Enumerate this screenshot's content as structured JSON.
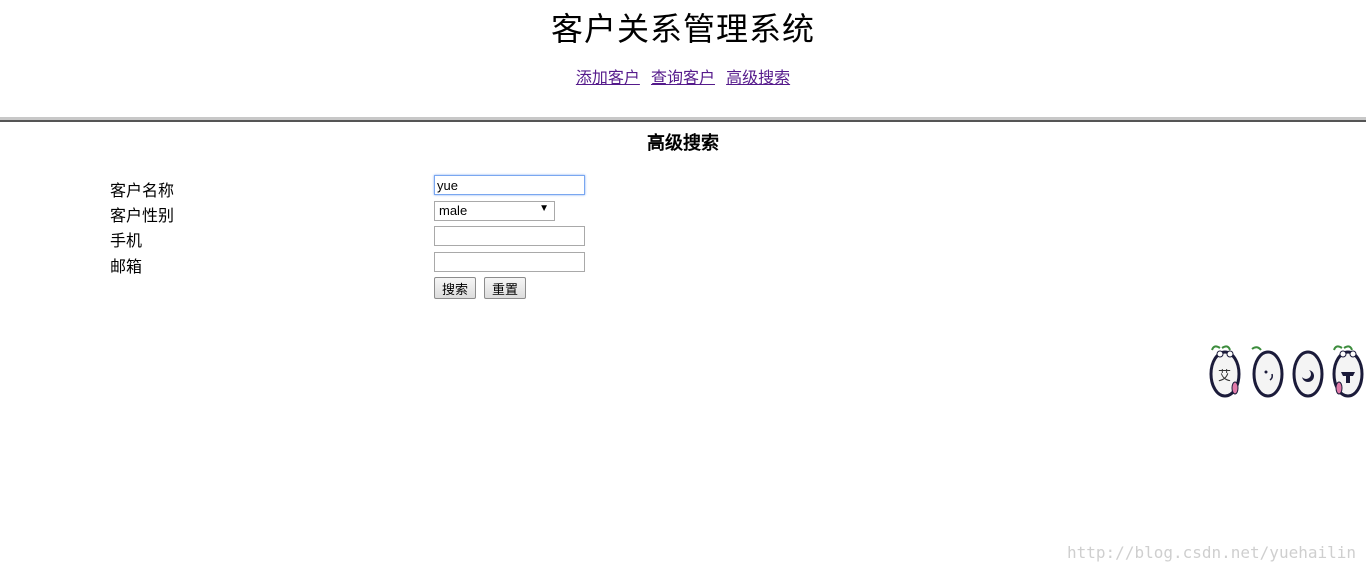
{
  "header": {
    "title": "客户关系管理系统",
    "nav": [
      {
        "label": "添加客户"
      },
      {
        "label": "查询客户"
      },
      {
        "label": "高级搜索"
      }
    ]
  },
  "search_form": {
    "title": "高级搜索",
    "fields": {
      "name": {
        "label": "客户名称",
        "value": "yue"
      },
      "gender": {
        "label": "客户性别",
        "selected": "male"
      },
      "phone": {
        "label": "手机",
        "value": ""
      },
      "email": {
        "label": "邮箱",
        "value": ""
      }
    },
    "buttons": {
      "search": "搜索",
      "reset": "重置"
    }
  },
  "decoration": {
    "icon": "cartoon-seed-characters"
  },
  "watermark": "http://blog.csdn.net/yuehailin"
}
